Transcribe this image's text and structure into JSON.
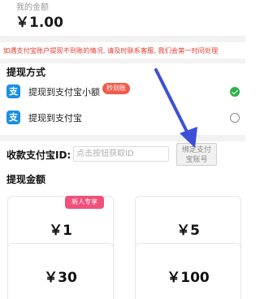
{
  "balance": {
    "label": "我的金额",
    "amount": "￥1.00"
  },
  "notice": "如遇支付宝账户提现不到账的情况, 请及时联系客服, 我们会第一时间处理",
  "methods": {
    "title": "提现方式",
    "items": [
      {
        "label": "提现到支付宝小额",
        "badge": "秒到账",
        "selected": true
      },
      {
        "label": "提现到支付宝",
        "selected": false
      }
    ]
  },
  "account": {
    "label": "收款支付宝ID:",
    "placeholder": "点击按钮获取ID",
    "bind_line1": "绑定支付",
    "bind_line2": "宝账号"
  },
  "amounts": {
    "title": "提现金额",
    "options": [
      {
        "value": "￥1",
        "badge": "新人专享"
      },
      {
        "value": "￥5"
      },
      {
        "value": "￥30"
      },
      {
        "value": "￥100"
      }
    ]
  },
  "icons": {
    "alipay": "alipay-icon",
    "check": "check-icon"
  },
  "colors": {
    "accent_red": "#e23b2e",
    "alipay_blue": "#1a8fe3",
    "selected_green": "#2bb24c",
    "badge_pink": "#f0517a",
    "annotation_arrow": "#3d4fd6"
  }
}
